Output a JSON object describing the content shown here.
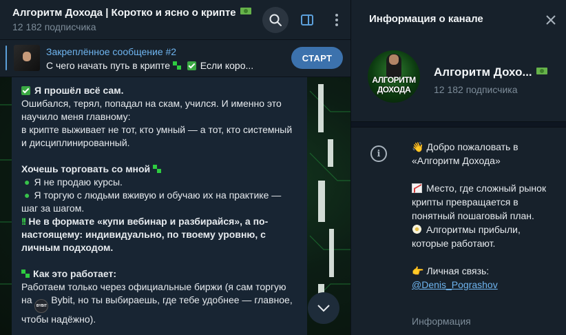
{
  "chat": {
    "title": "Алгоритм Дохода | Коротко и ясно о крипте",
    "subscribers": "12 182 подписчика",
    "pinned": {
      "title": "Закреплённое сообщение #2",
      "text": "С чего начать путь в крипте",
      "text_more": "Если коро...",
      "start_label": "СТАРТ"
    },
    "message": {
      "l1": "Я прошёл всё сам.",
      "l2": "Ошибался, терял, попадал на скам, учился. И именно это научило меня главному:",
      "l3": "в крипте выживает не тот, кто умный — а тот, кто системный и дисциплинированный.",
      "l4": "Хочешь торговать со мной",
      "b1": "Я не продаю курсы.",
      "b2": "Я торгую с людьми вживую и обучаю их на практике — шаг за шагом.",
      "l5": "Не в формате «купи вебинар и разбирайся», а по-настоящему: индивидуально, по твоему уровню, с личным подходом.",
      "l6": "Как это работает:",
      "l7a": "Работаем только через официальные биржи (я сам торгую на ",
      "l7b": " Bybit, но ты выбираешь, где тебе удобнее — главное, чтобы надёжно)."
    }
  },
  "info": {
    "panel_title": "Информация о канале",
    "name": "Алгоритм Дохо...",
    "subscribers": "12 182 подписчика",
    "avatar_text_1": "АЛГОРИТМ",
    "avatar_text_2": "ДОХОДА",
    "description": {
      "d1": "Добро пожаловать в «Алгоритм Дохода»",
      "d2": "Место, где сложный рынок крипты превращается в понятный пошаговый план.",
      "d3": "Алгоритмы прибыли, которые работают.",
      "d4": "Личная связь:",
      "link": "@Denis_Pograshov"
    },
    "description_label": "Информация"
  },
  "icons": {
    "search": "search-icon",
    "panel": "side-panel-icon",
    "more": "more-vertical-icon",
    "close": "close-icon",
    "info": "info-icon",
    "down": "chevron-down-icon"
  },
  "colors": {
    "accent": "#5ca0db",
    "start_button": "#3c72ad",
    "link": "#6fb5f0",
    "background": "#17212b"
  }
}
